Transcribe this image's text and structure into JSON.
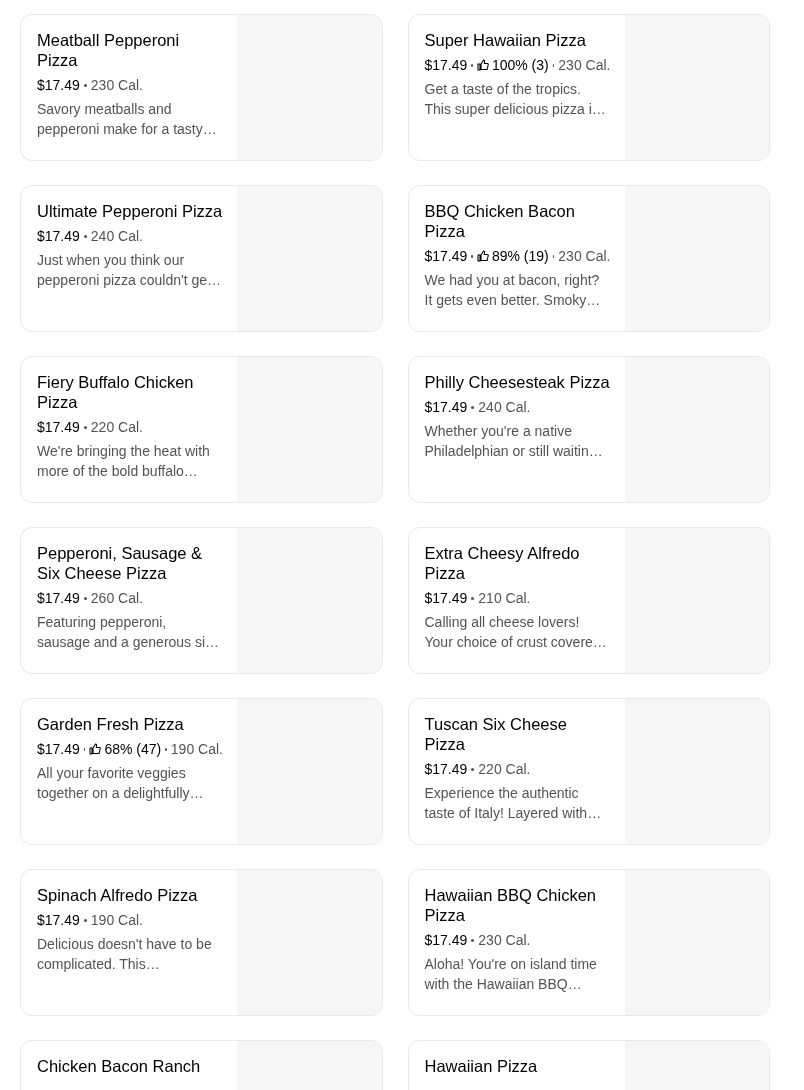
{
  "items": [
    {
      "title": "Meatball Pepperoni Pizza",
      "price": "$17.49",
      "calories": "230 Cal.",
      "description": "Savory meatballs and pepperoni make for a tasty…"
    },
    {
      "title": "Super Hawaiian Pizza",
      "price": "$17.49",
      "rating": "100% (3)",
      "calories": "230 Cal.",
      "description": "Get a taste of the tropics. This super delicious pizza i…"
    },
    {
      "title": "Ultimate Pepperoni Pizza",
      "price": "$17.49",
      "calories": "240 Cal.",
      "description": "Just when you think our pepperoni pizza couldn't ge…"
    },
    {
      "title": "BBQ Chicken Bacon Pizza",
      "price": "$17.49",
      "rating": "89% (19)",
      "calories": "230 Cal.",
      "description": "We had you at bacon, right? It gets even better. Smoky…"
    },
    {
      "title": "Fiery Buffalo Chicken Pizza",
      "price": "$17.49",
      "calories": "220 Cal.",
      "description": "We're bringing the heat with more of the bold buffalo…"
    },
    {
      "title": "Philly Cheesesteak Pizza",
      "price": "$17.49",
      "calories": "240 Cal.",
      "description": "Whether you're a native Philadelphian or still waitin…"
    },
    {
      "title": "Pepperoni, Sausage & Six Cheese Pizza",
      "price": "$17.49",
      "calories": "260 Cal.",
      "description": "Featuring pepperoni, sausage and a generous si…"
    },
    {
      "title": "Extra Cheesy Alfredo Pizza",
      "price": "$17.49",
      "calories": "210 Cal.",
      "description": "Calling all cheese lovers! Your choice of crust covere…"
    },
    {
      "title": "Garden Fresh Pizza",
      "price": "$17.49",
      "rating": "68% (47)",
      "calories": "190 Cal.",
      "description": "All your favorite veggies together on a delightfully…"
    },
    {
      "title": "Tuscan Six Cheese Pizza",
      "price": "$17.49",
      "calories": "220 Cal.",
      "description": "Experience the authentic taste of Italy! Layered with…"
    },
    {
      "title": "Spinach Alfredo Pizza",
      "price": "$17.49",
      "calories": "190 Cal.",
      "description": "Delicious doesn't have to be complicated. This…"
    },
    {
      "title": "Hawaiian BBQ Chicken Pizza",
      "price": "$17.49",
      "calories": "230 Cal.",
      "description": "Aloha! You're on island time with the Hawaiian BBQ…"
    },
    {
      "title": "Chicken Bacon Ranch"
    },
    {
      "title": "Hawaiian Pizza"
    }
  ]
}
